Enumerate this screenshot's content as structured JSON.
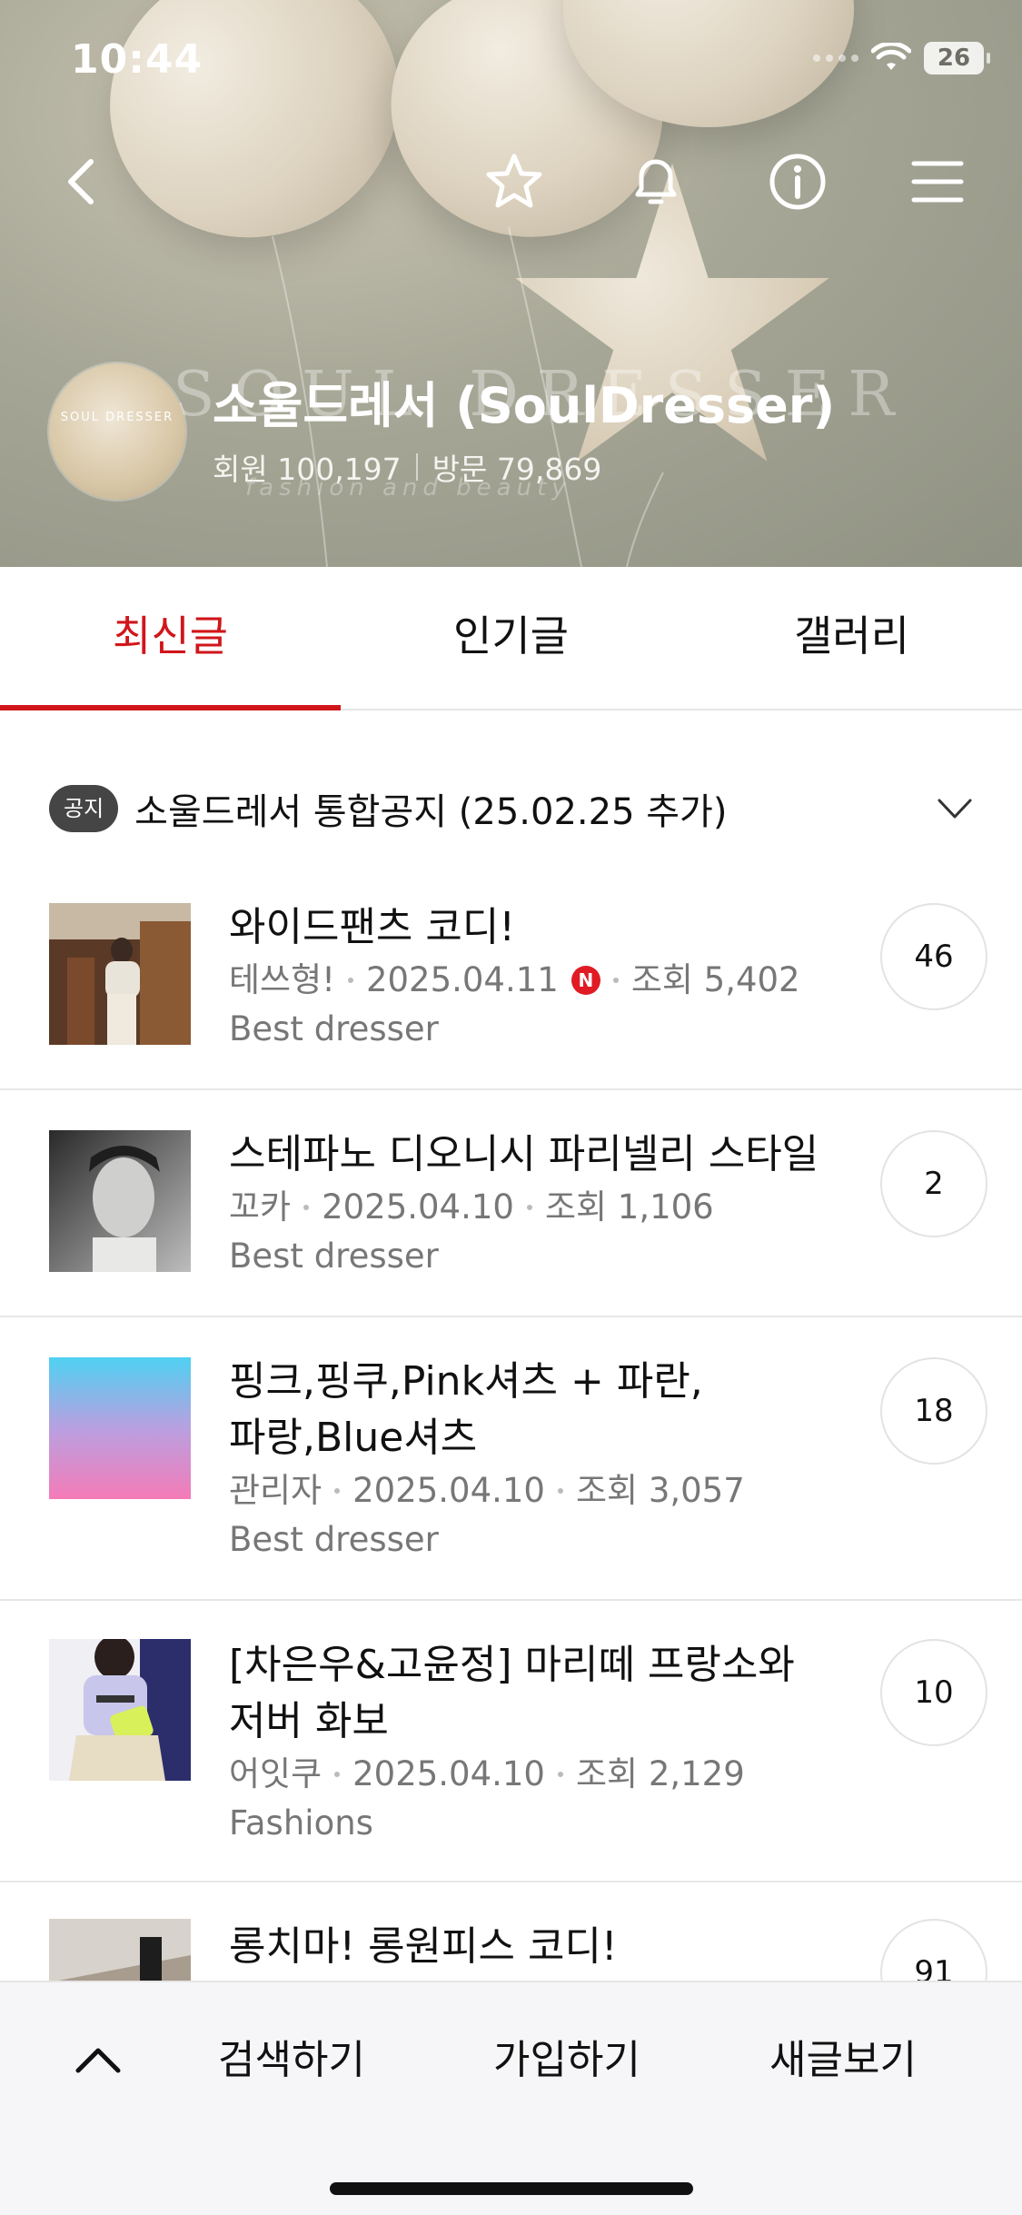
{
  "status_bar": {
    "time": "10:44",
    "battery": "26"
  },
  "header": {
    "cafe_name": "소울드레서 (SoulDresser)",
    "stats": {
      "members": "회원 100,197",
      "visits": "방문 79,869"
    },
    "avatar_text": "SOUL DRESSER",
    "watermark": "SOUL DRESSER",
    "watermark_sub": "fashion and beauty"
  },
  "nav_icons": [
    "back-icon",
    "star-icon",
    "bell-icon",
    "info-icon",
    "menu-icon"
  ],
  "tabs": [
    {
      "label": "최신글",
      "active": true
    },
    {
      "label": "인기글",
      "active": false
    },
    {
      "label": "갤러리",
      "active": false
    }
  ],
  "notice": {
    "badge": "공지",
    "title": "소울드레서 통합공지 (25.02.25 추가)"
  },
  "posts": [
    {
      "title": "와이드팬츠 코디!",
      "author": "테쓰형!",
      "date": "2025.04.11",
      "new_badge": "N",
      "views": "조회 5,402",
      "board": "Best dresser",
      "comments": "46"
    },
    {
      "title": "스테파노 디오니시 파리넬리 스타일",
      "author": "꼬카",
      "date": "2025.04.10",
      "views": "조회 1,106",
      "board": "Best dresser",
      "comments": "2"
    },
    {
      "title": "핑크,핑쿠,Pink셔츠 + 파란,파랑,Blue셔츠",
      "author": "관리자",
      "date": "2025.04.10",
      "views": "조회 3,057",
      "board": "Best dresser",
      "comments": "18"
    },
    {
      "title": "[차은우&고윤정] 마리떼 프랑소와 저버 화보",
      "author": "어잇쿠",
      "date": "2025.04.10",
      "views": "조회 2,129",
      "board": "Fashions",
      "comments": "10"
    },
    {
      "title": "롱치마! 롱원피스 코디!",
      "comments": "91"
    }
  ],
  "bottom_bar": {
    "search": "검색하기",
    "join": "가입하기",
    "new_posts": "새글보기"
  },
  "colors": {
    "accent": "#d0161b",
    "new_badge": "#e01b24",
    "header_bg": "#9c9d8d"
  }
}
